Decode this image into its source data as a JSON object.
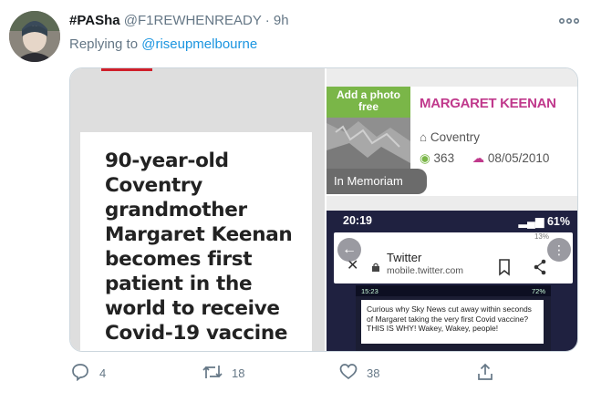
{
  "tweet": {
    "display_name": "#PASha",
    "handle": "@F1REWHENREADY",
    "dot": "·",
    "time": "9h",
    "reply_prefix": "Replying to",
    "reply_to": "@riseupmelbourne",
    "more_icon": "more-horizontal-icon"
  },
  "media": {
    "left": {
      "headline": "90-year-old Coventry grandmother Margaret Keenan becomes first patient in the world to receive Covid-19 vaccine",
      "accent_color": "#d01f2a"
    },
    "memorial": {
      "add_photo": "Add a photo free",
      "tag": "In Memoriam",
      "name": "MARGARET KEENAN",
      "place": "Coventry",
      "views": "363",
      "date": "08/05/2010",
      "name_color": "#c0398c"
    },
    "phone": {
      "time": "20:19",
      "battery": "61%",
      "mini_status": "13%",
      "browser_title": "Twitter",
      "browser_url": "mobile.twitter.com",
      "inner_time": "15:23",
      "inner_battery": "72%",
      "inner_tweet": "Curious why Sky News cut away within seconds of Margaret taking the very first Covid vaccine? THIS IS WHY! Wakey, Wakey, people!"
    }
  },
  "actions": {
    "replies": "4",
    "retweets": "18",
    "likes": "38"
  }
}
